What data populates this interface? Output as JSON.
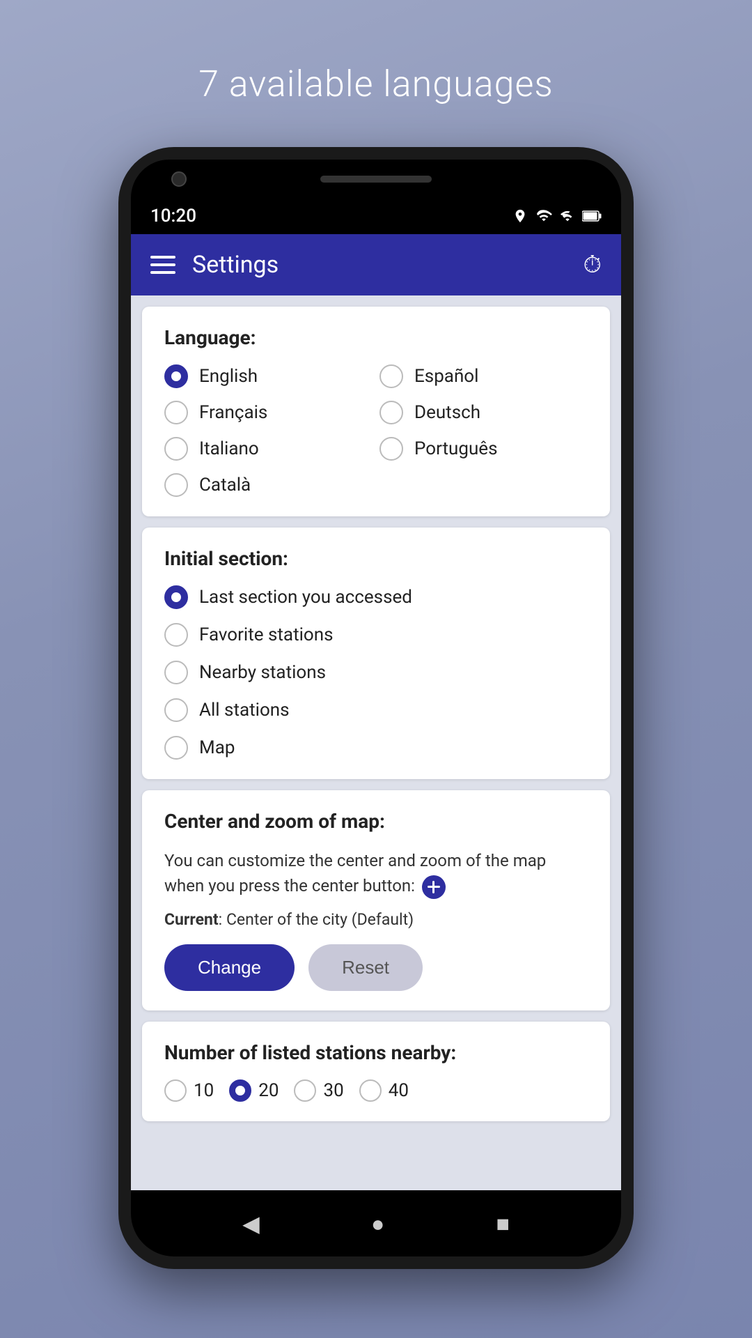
{
  "header": {
    "title": "7 available languages"
  },
  "appbar": {
    "title": "Settings",
    "menu_icon": "hamburger-icon",
    "action_icon": "timer-icon"
  },
  "status_bar": {
    "time": "10:20"
  },
  "language_section": {
    "title": "Language:",
    "options": [
      {
        "id": "english",
        "label": "English",
        "selected": true
      },
      {
        "id": "espanol",
        "label": "Español",
        "selected": false
      },
      {
        "id": "francais",
        "label": "Français",
        "selected": false
      },
      {
        "id": "deutsch",
        "label": "Deutsch",
        "selected": false
      },
      {
        "id": "italiano",
        "label": "Italiano",
        "selected": false
      },
      {
        "id": "portugues",
        "label": "Português",
        "selected": false
      },
      {
        "id": "catala",
        "label": "Català",
        "selected": false
      }
    ]
  },
  "initial_section": {
    "title": "Initial section:",
    "options": [
      {
        "id": "last",
        "label": "Last section you accessed",
        "selected": true
      },
      {
        "id": "favorite",
        "label": "Favorite stations",
        "selected": false
      },
      {
        "id": "nearby",
        "label": "Nearby stations",
        "selected": false
      },
      {
        "id": "all",
        "label": "All stations",
        "selected": false
      },
      {
        "id": "map",
        "label": "Map",
        "selected": false
      }
    ]
  },
  "center_zoom_section": {
    "title": "Center and zoom of map:",
    "description": "You can customize the center and zoom of the map when you press the center button:",
    "current_label": "Current",
    "current_value": "Center of the city (Default)",
    "change_button": "Change",
    "reset_button": "Reset"
  },
  "nearby_section": {
    "title": "Number of listed stations nearby:",
    "options": [
      {
        "id": "10",
        "label": "10",
        "selected": false
      },
      {
        "id": "20",
        "label": "20",
        "selected": true
      },
      {
        "id": "30",
        "label": "30",
        "selected": false
      },
      {
        "id": "40",
        "label": "40",
        "selected": false
      }
    ]
  },
  "bottom_nav": {
    "back": "◀",
    "home": "●",
    "recent": "■"
  }
}
